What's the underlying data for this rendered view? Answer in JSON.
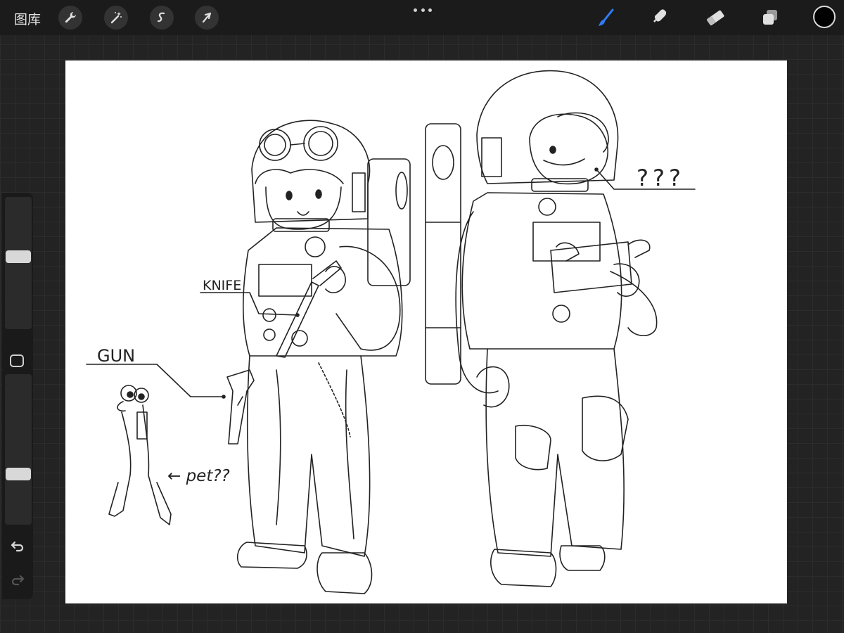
{
  "toolbar": {
    "gallery_label": "图库",
    "tools_left": [
      "wrench-icon",
      "magic-wand-icon",
      "selection-icon",
      "transform-arrow-icon"
    ],
    "tools_right": [
      "brush-icon",
      "smudge-icon",
      "eraser-icon",
      "layers-icon"
    ],
    "active_tool": "brush-icon",
    "current_color": "#000000",
    "accent_color": "#2f7df6"
  },
  "sidebar": {
    "brush_size_level": 0.55,
    "opacity_level": 0.32
  },
  "canvas": {
    "annotations": {
      "knife": "KNIFE",
      "gun": "GUN",
      "pet": "← pet??",
      "unknown": "???"
    }
  }
}
